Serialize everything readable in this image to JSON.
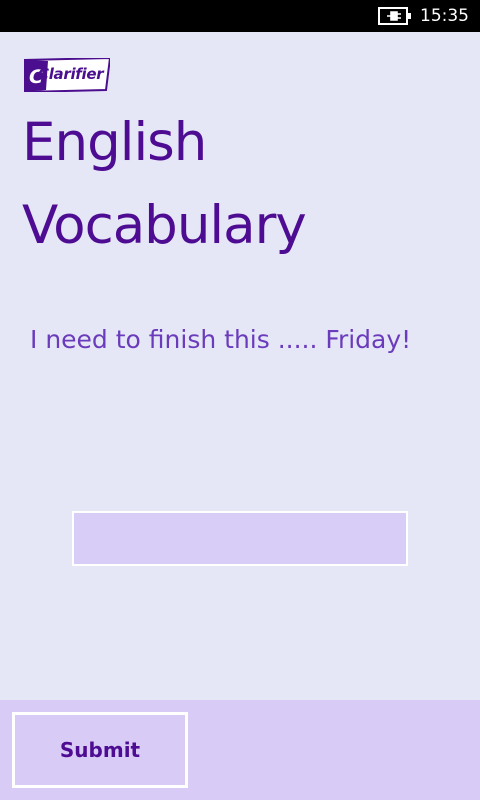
{
  "status_bar": {
    "time": "15:35",
    "battery_icon": "battery-charging-icon"
  },
  "logo": {
    "text": "Clarifier"
  },
  "title": {
    "line1": "English",
    "line2": "Vocabulary"
  },
  "question": {
    "text": "I need to finish this ..... Friday!"
  },
  "answer": {
    "value": ""
  },
  "app_bar": {
    "submit_label": "Submit"
  },
  "colors": {
    "background": "#e5e7f7",
    "title": "#4e0c92",
    "question": "#6a3bbb",
    "input_fill": "#d8cdf7",
    "app_bar": "#d8ccf7"
  }
}
